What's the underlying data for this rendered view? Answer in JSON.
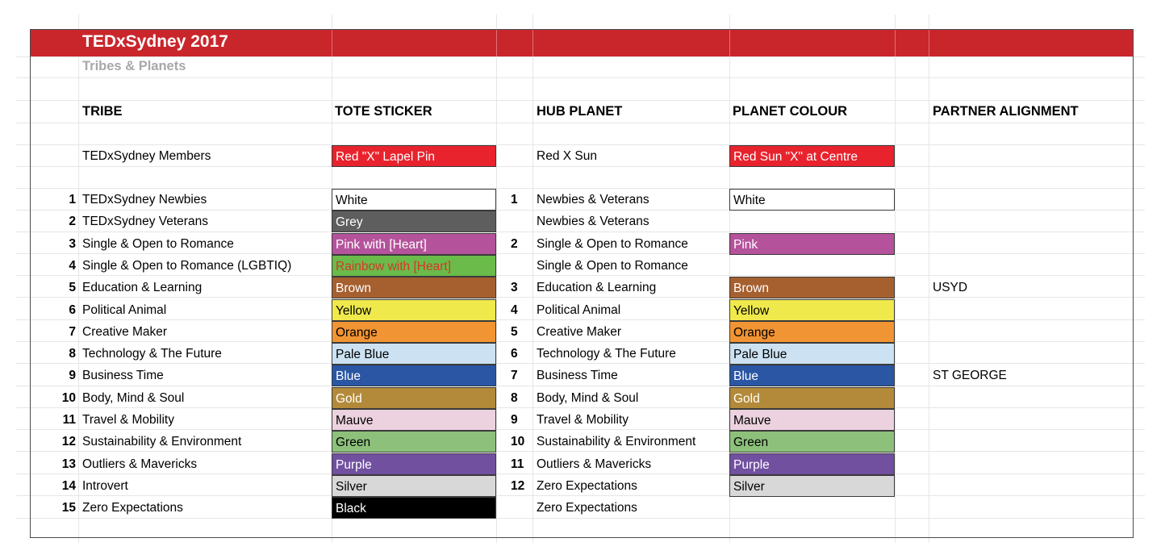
{
  "sheet": {
    "title": "TEDxSydney 2017",
    "subtitle": "Tribes & Planets",
    "accent_color": "#c9262c"
  },
  "headers": {
    "tribe": "TRIBE",
    "tote": "TOTE STICKER",
    "hub": "HUB PLANET",
    "planet_colour": "PLANET COLOUR",
    "partner": "PARTNER ALIGNMENT"
  },
  "members": {
    "tribe": "TEDxSydney Members",
    "tote": "Red \"X\" Lapel Pin",
    "tote_color": "#e8232d",
    "hub": "Red X Sun",
    "planet": "Red Sun \"X\" at Centre",
    "planet_color": "#e8232d"
  },
  "rows": [
    {
      "num": "1",
      "tribe": "TEDxSydney Newbies",
      "tote": "White",
      "tote_bg": "#ffffff",
      "tote_fg": "#000000",
      "hub_num": "1",
      "hub": "Newbies & Veterans",
      "planet": "White",
      "planet_bg": "#ffffff",
      "planet_fg": "#000000",
      "partner": ""
    },
    {
      "num": "2",
      "tribe": "TEDxSydney Veterans",
      "tote": "Grey",
      "tote_bg": "#5e5e5e",
      "tote_fg": "#ffffff",
      "hub_num": "",
      "hub": "Newbies & Veterans",
      "planet": "",
      "planet_bg": "",
      "planet_fg": "",
      "partner": ""
    },
    {
      "num": "3",
      "tribe": "Single & Open to Romance",
      "tote": "Pink with [Heart]",
      "tote_bg": "#b4529b",
      "tote_fg": "#ffffff",
      "hub_num": "2",
      "hub": "Single & Open to Romance",
      "planet": "Pink",
      "planet_bg": "#b4529b",
      "planet_fg": "#ffffff",
      "partner": ""
    },
    {
      "num": "4",
      "tribe": "Single & Open to Romance (LGBTIQ)",
      "tote": "Rainbow with [Heart]",
      "tote_bg": "#6abb4a",
      "tote_fg": "#d7352b",
      "hub_num": "",
      "hub": "Single & Open to Romance",
      "planet": "",
      "planet_bg": "",
      "planet_fg": "",
      "partner": ""
    },
    {
      "num": "5",
      "tribe": "Education & Learning",
      "tote": "Brown",
      "tote_bg": "#a6602f",
      "tote_fg": "#ffffff",
      "hub_num": "3",
      "hub": "Education & Learning",
      "planet": "Brown",
      "planet_bg": "#a6602f",
      "planet_fg": "#ffffff",
      "partner": "USYD"
    },
    {
      "num": "6",
      "tribe": "Political Animal",
      "tote": "Yellow",
      "tote_bg": "#efe94c",
      "tote_fg": "#000000",
      "hub_num": "4",
      "hub": "Political Animal",
      "planet": "Yellow",
      "planet_bg": "#efe94c",
      "planet_fg": "#000000",
      "partner": ""
    },
    {
      "num": "7",
      "tribe": "Creative Maker",
      "tote": "Orange",
      "tote_bg": "#f19433",
      "tote_fg": "#000000",
      "hub_num": "5",
      "hub": "Creative Maker",
      "planet": "Orange",
      "planet_bg": "#f19433",
      "planet_fg": "#000000",
      "partner": ""
    },
    {
      "num": "8",
      "tribe": "Technology & The Future",
      "tote": "Pale Blue",
      "tote_bg": "#cce2f2",
      "tote_fg": "#000000",
      "hub_num": "6",
      "hub": "Technology & The Future",
      "planet": "Pale Blue",
      "planet_bg": "#cce2f2",
      "planet_fg": "#000000",
      "partner": ""
    },
    {
      "num": "9",
      "tribe": "Business Time",
      "tote": "Blue",
      "tote_bg": "#2a56a4",
      "tote_fg": "#ffffff",
      "hub_num": "7",
      "hub": "Business Time",
      "planet": "Blue",
      "planet_bg": "#2a56a4",
      "planet_fg": "#ffffff",
      "partner": "ST GEORGE"
    },
    {
      "num": "10",
      "tribe": "Body, Mind & Soul",
      "tote": "Gold",
      "tote_bg": "#b38a3a",
      "tote_fg": "#ffffff",
      "hub_num": "8",
      "hub": "Body, Mind & Soul",
      "planet": "Gold",
      "planet_bg": "#b38a3a",
      "planet_fg": "#ffffff",
      "partner": ""
    },
    {
      "num": "11",
      "tribe": "Travel & Mobility",
      "tote": "Mauve",
      "tote_bg": "#ecd2df",
      "tote_fg": "#000000",
      "hub_num": "9",
      "hub": "Travel & Mobility",
      "planet": "Mauve",
      "planet_bg": "#ecd2df",
      "planet_fg": "#000000",
      "partner": ""
    },
    {
      "num": "12",
      "tribe": "Sustainability & Environment",
      "tote": "Green",
      "tote_bg": "#8dc17b",
      "tote_fg": "#000000",
      "hub_num": "10",
      "hub": "Sustainability & Environment",
      "planet": "Green",
      "planet_bg": "#8dc17b",
      "planet_fg": "#000000",
      "partner": ""
    },
    {
      "num": "13",
      "tribe": "Outliers & Mavericks",
      "tote": "Purple",
      "tote_bg": "#7150a0",
      "tote_fg": "#ffffff",
      "hub_num": "11",
      "hub": "Outliers & Mavericks",
      "planet": "Purple",
      "planet_bg": "#7150a0",
      "planet_fg": "#ffffff",
      "partner": ""
    },
    {
      "num": "14",
      "tribe": "Introvert",
      "tote": "Silver",
      "tote_bg": "#d8d8d8",
      "tote_fg": "#000000",
      "hub_num": "12",
      "hub": "Zero Expectations",
      "planet": "Silver",
      "planet_bg": "#d8d8d8",
      "planet_fg": "#000000",
      "partner": ""
    },
    {
      "num": "15",
      "tribe": "Zero Expectations",
      "tote": "Black",
      "tote_bg": "#000000",
      "tote_fg": "#ffffff",
      "hub_num": "",
      "hub": "Zero Expectations",
      "planet": "",
      "planet_bg": "",
      "planet_fg": "",
      "partner": ""
    }
  ]
}
